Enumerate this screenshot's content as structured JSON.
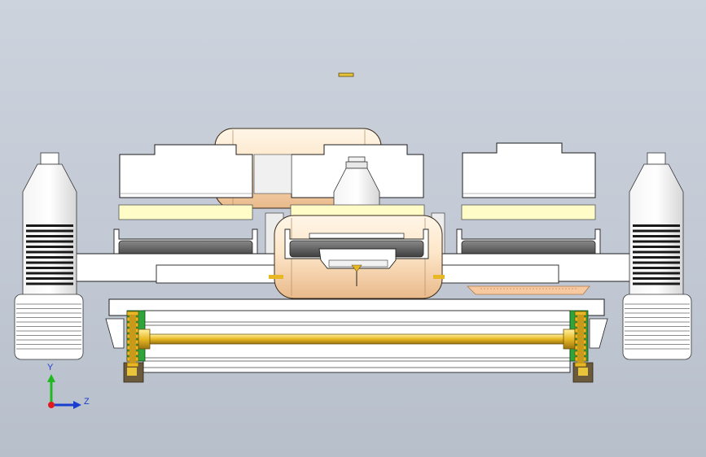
{
  "viewport": {
    "background_top": "#cdd3dd",
    "background_bottom": "#b7bfcb"
  },
  "model": {
    "view": "front",
    "parts": [
      "bottle-left",
      "bottle-right",
      "gripper-block-left",
      "gripper-block-center",
      "gripper-block-right",
      "yellow-pad-left",
      "yellow-pad-center",
      "yellow-pad-right",
      "tray-left",
      "tray-center",
      "tray-right",
      "cross-beam",
      "rear-cylinder",
      "front-cylinder",
      "center-cap",
      "roller-frame",
      "drive-shaft",
      "sprocket-left",
      "sprocket-right",
      "side-bracket-left",
      "side-bracket-right",
      "canister-left",
      "canister-right",
      "peach-tray"
    ],
    "colors": {
      "steel": "#ffffff",
      "outline": "#1e1e1e",
      "shaft": "#e8b824",
      "pad": "#fffcc8",
      "cylinder": "#fde6c8",
      "bracket_green": "#2ea43a",
      "bracket_brown": "#6b5a3c",
      "tray_dark": "#5a5a5a",
      "peach": "#f7c9a0"
    }
  },
  "triad": {
    "y_label": "Y",
    "z_label": "Z",
    "y_color": "#1fb91f",
    "z_color": "#1a3ed0",
    "origin_color": "#e11b1b"
  }
}
